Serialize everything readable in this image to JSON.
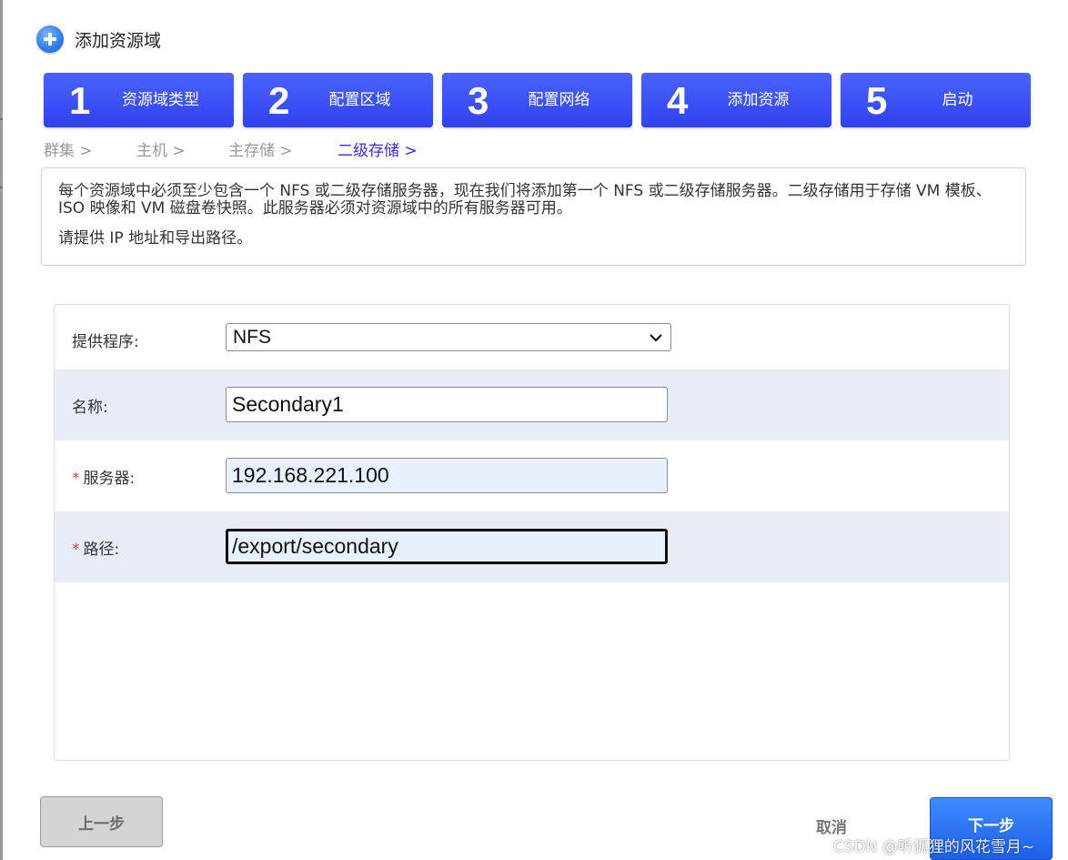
{
  "dialog": {
    "title": "添加资源域"
  },
  "steps": [
    {
      "num": "1",
      "label": "资源域类型"
    },
    {
      "num": "2",
      "label": "配置区域"
    },
    {
      "num": "3",
      "label": "配置网络"
    },
    {
      "num": "4",
      "label": "添加资源"
    },
    {
      "num": "5",
      "label": "启动"
    }
  ],
  "breadcrumb": [
    {
      "label": "群集 >",
      "active": false
    },
    {
      "label": "主机 >",
      "active": false
    },
    {
      "label": "主存储 >",
      "active": false
    },
    {
      "label": "二级存储 >",
      "active": true
    }
  ],
  "info": {
    "paragraph1": "每个资源域中必须至少包含一个 NFS 或二级存储服务器，现在我们将添加第一个 NFS 或二级存储服务器。二级存储用于存储 VM 模板、ISO 映像和 VM 磁盘卷快照。此服务器必须对资源域中的所有服务器可用。",
    "paragraph2": "请提供 IP 地址和导出路径。"
  },
  "form": {
    "provider": {
      "label": "提供程序:",
      "value": "NFS"
    },
    "name": {
      "label": "名称:",
      "value": "Secondary1"
    },
    "server": {
      "label": "服务器:",
      "value": "192.168.221.100",
      "required_mark": "*"
    },
    "path": {
      "label": "路径:",
      "value": "/export/secondary",
      "required_mark": "*"
    }
  },
  "buttons": {
    "back": "上一步",
    "cancel": "取消",
    "next": "下一步"
  },
  "watermark": "CSDN @听狐狸的风花雪月~",
  "colors": {
    "step_bg": "#3a52f8",
    "breadcrumb_active": "#3a2be0",
    "required": "#e0433a",
    "next_button": "#2f73f2"
  }
}
